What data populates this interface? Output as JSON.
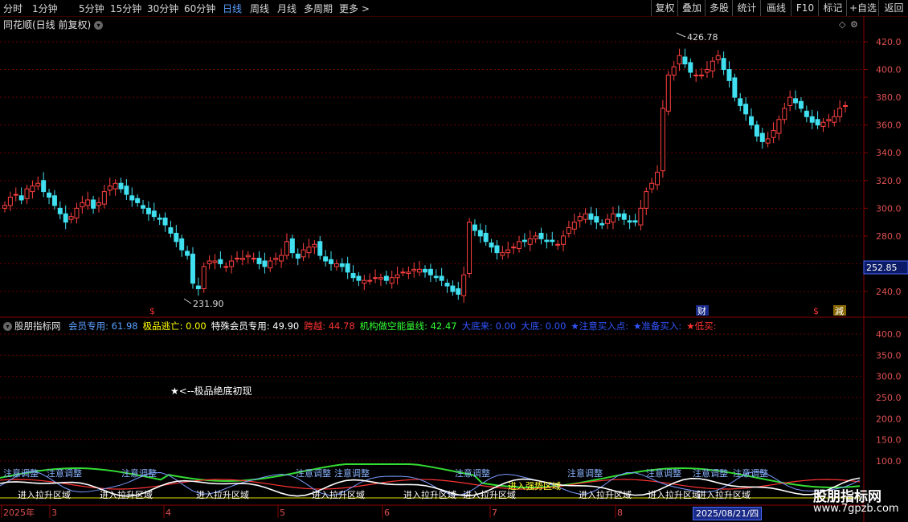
{
  "toolbar": {
    "periods": [
      "分时",
      "1分钟",
      "5分钟",
      "15分钟",
      "30分钟",
      "60分钟",
      "日线",
      "周线",
      "月线",
      "多周期",
      "更多 >"
    ],
    "active_period": "日线",
    "right_buttons": [
      "复权",
      "叠加",
      "多股",
      "统计",
      "画线",
      "F10",
      "标记",
      "+自选",
      "返回"
    ]
  },
  "chart_title": "同花顺(日线 前复权)",
  "price_axis": [
    "420.0",
    "400.0",
    "380.0",
    "360.0",
    "340.0",
    "320.0",
    "300.0",
    "280.0",
    "260.0",
    "240.0"
  ],
  "current_price": "252.85",
  "high_label": "426.78",
  "low_label": "231.90",
  "markers": {
    "cai": "财",
    "jian": "減",
    "dollar": "$"
  },
  "indicator": {
    "name": "股朋指标网",
    "items": [
      {
        "label": "会员专用: 61.98",
        "color": "#5aa0ff"
      },
      {
        "label": "极品逃亡: 0.00",
        "color": "#ffff00"
      },
      {
        "label": "特殊会员专用: 49.90",
        "color": "#ffffff"
      },
      {
        "label": "跨越: 44.78",
        "color": "#ff3333"
      },
      {
        "label": "机构做空能量线: 42.47",
        "color": "#33ff33"
      },
      {
        "label": "大底来: 0.00",
        "color": "#3355ff"
      },
      {
        "label": "大底: 0.00",
        "color": "#3355ff"
      },
      {
        "label": "★注意买入点:",
        "color": "#3355ff"
      },
      {
        "label": "★准备买入:",
        "color": "#3355ff"
      },
      {
        "label": "★低买:",
        "color": "#ff3333"
      }
    ],
    "axis": [
      "400.0",
      "350.0",
      "300.0",
      "250.0",
      "200.0",
      "150.0",
      "100.0"
    ],
    "note": "★<--极品绝底初现",
    "zone_labels": [
      "注意调整",
      "注意调整",
      "注意调整",
      "注意调整",
      "注意调整",
      "注意调整",
      "注意调整",
      "注意调整",
      "注意调整",
      "注意调整",
      "注意调整"
    ],
    "entry_labels": [
      "进入拉升区域",
      "进入拉升区域",
      "进入拉升区域",
      "进入拉升区域",
      "进入拉升区域",
      "进入拉升区域",
      "进入拉升区域",
      "进入拉升区域",
      "进入拉升区域"
    ],
    "strong_label": "进入强势区域"
  },
  "date_axis": [
    "2025年",
    "3",
    "4",
    "5",
    "6",
    "7",
    "8"
  ],
  "date_badge": "2025/08/21/四",
  "watermark": {
    "title": "股朋指标网",
    "url": "www.7gpzb.com"
  }
}
